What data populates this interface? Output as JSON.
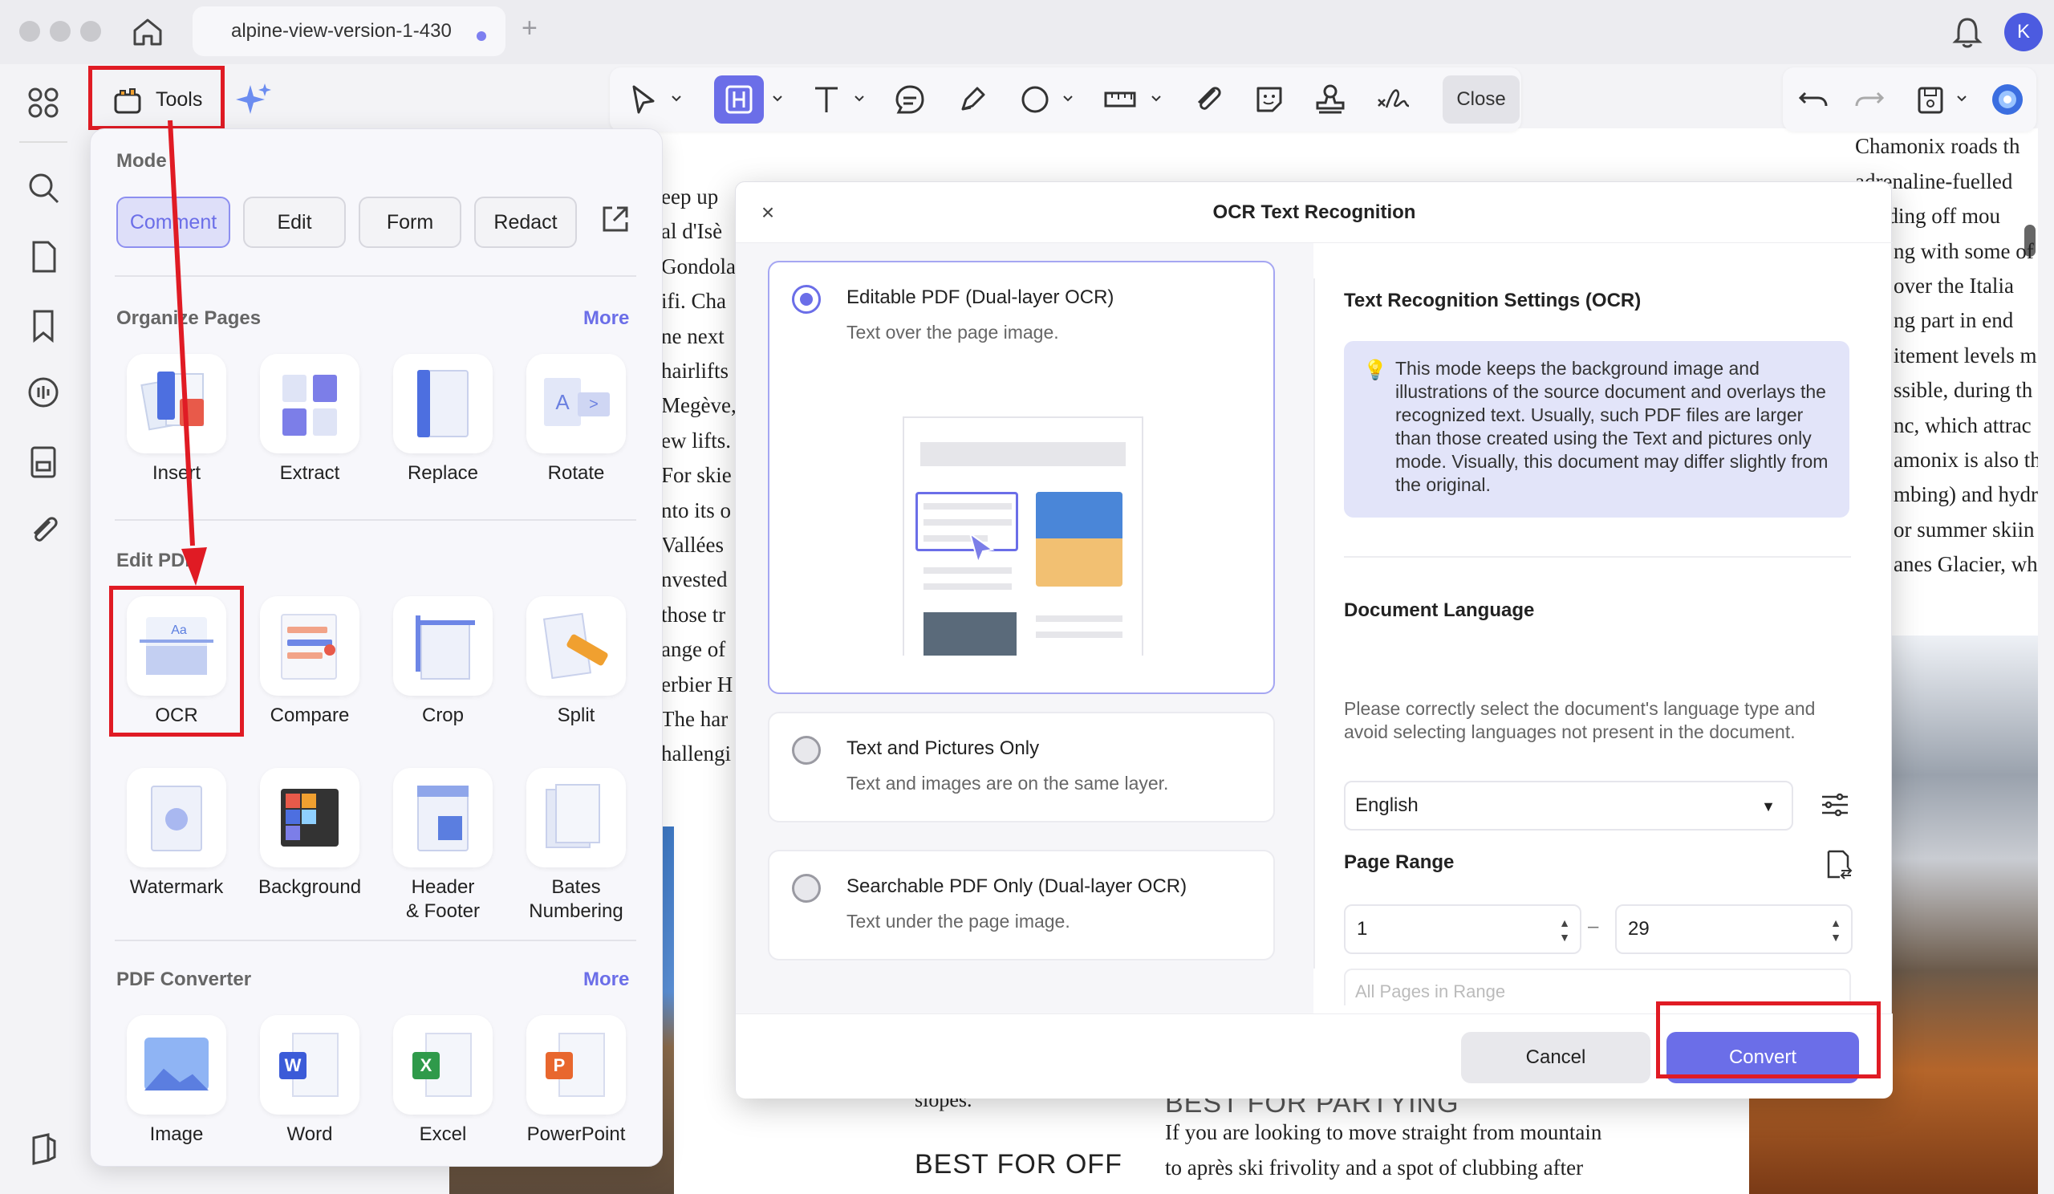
{
  "titlebar": {
    "tab_title": "alpine-view-version-1-430",
    "new_tab": "+",
    "avatar_initial": "K"
  },
  "tools": {
    "label": "Tools"
  },
  "toolbar": {
    "close_label": "Close"
  },
  "panel": {
    "mode_title": "Mode",
    "modes": [
      "Comment",
      "Edit",
      "Form",
      "Redact"
    ],
    "organize_title": "Organize Pages",
    "organize_more": "More",
    "organize_tools": [
      "Insert",
      "Extract",
      "Replace",
      "Rotate"
    ],
    "edit_title": "Edit PDF",
    "edit_tools": [
      "OCR",
      "Compare",
      "Crop",
      "Split"
    ],
    "edit_tools_2": [
      "Watermark",
      "Background",
      "Header\n& Footer",
      "Bates\nNumbering"
    ],
    "converter_title": "PDF Converter",
    "converter_more": "More",
    "converter_tools": [
      "Image",
      "Word",
      "Excel",
      "PowerPoint"
    ]
  },
  "document": {
    "left_lines": [
      "eep up",
      "al d'Isè",
      "Gondola,",
      "ifi. Cha",
      "ne next",
      "hairlifts",
      "Megève,",
      "ew lifts.",
      "For skie",
      "nto its o",
      "Vallées",
      "nvested",
      "those tr",
      "ange of",
      "erbier H",
      "The har",
      "hallengi"
    ],
    "right_lines": [
      ")",
      "Chamonix roads th",
      "adrenaline-fuelled",
      "agliding off mou",
      "ng with some of",
      "over the Italia",
      "ng part in end",
      "itement levels m",
      "ssible, during th",
      "nc, which attrac",
      "amonix is also th",
      "mbing) and hydro",
      "or summer skiin",
      "anes Glacier, wh"
    ],
    "bottom_slopes": "slopes.",
    "bottom_heading_left": "BEST FOR OFF",
    "bottom_heading_right": "BEST FOR PARTYING",
    "bottom_line_1": "If you are looking to move straight from mountain",
    "bottom_line_2": "to après ski frivolity and a spot of clubbing after"
  },
  "dialog": {
    "title": "OCR Text Recognition",
    "close": "×",
    "options": [
      {
        "title": "Editable PDF (Dual-layer OCR)",
        "subtitle": "Text over the page image.",
        "selected": true
      },
      {
        "title": "Text and Pictures Only",
        "subtitle": "Text and images are on the same layer.",
        "selected": false
      },
      {
        "title": "Searchable PDF Only (Dual-layer OCR)",
        "subtitle": "Text under the page image.",
        "selected": false
      }
    ],
    "settings_title": "Text Recognition Settings (OCR)",
    "info_text": "This mode keeps the background image and illustrations of the source document and overlays the recognized text. Usually, such PDF files are larger than those created using the Text and pictures only mode. Visually, this document may differ slightly from the original.",
    "language_title": "Document Language",
    "language_desc": "Please correctly select the document's language type and avoid selecting languages not present in the document.",
    "language_value": "English",
    "range_title": "Page Range",
    "range_from": "1",
    "range_to": "29",
    "range_dash": "–",
    "range_select": "All Pages in Range",
    "cancel_label": "Cancel",
    "convert_label": "Convert"
  },
  "colors": {
    "accent": "#6b6ee8",
    "highlight": "#e01b24"
  }
}
